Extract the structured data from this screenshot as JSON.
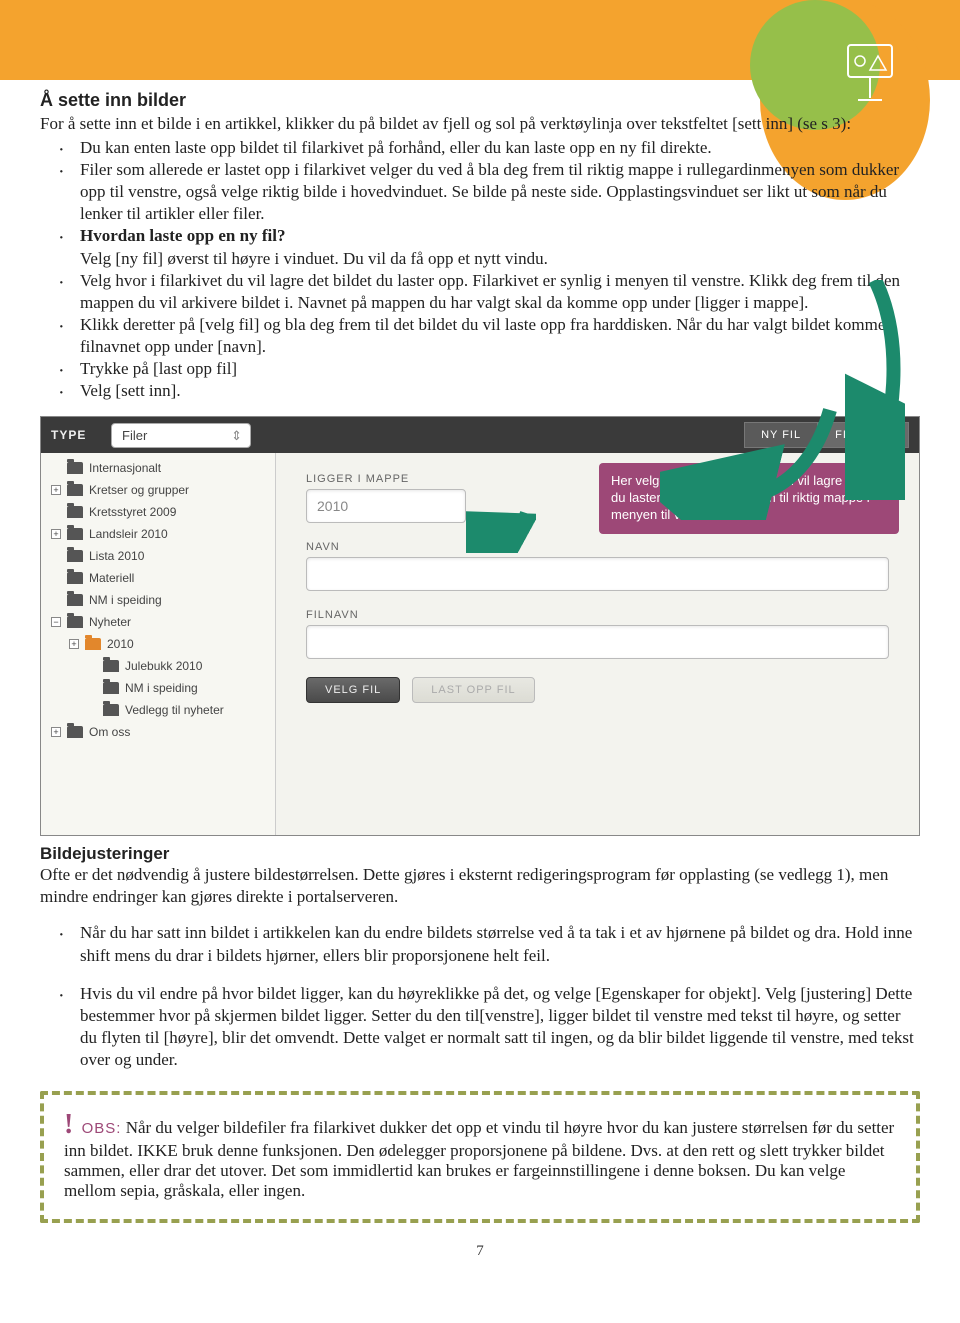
{
  "page_number": "7",
  "section1": {
    "heading": "Å sette inn bilder",
    "intro": "For å sette inn et bilde i en artikkel, klikker du på bildet av fjell og sol på verktøylinja over tekstfeltet [sett inn] (se s 3):",
    "bullets": [
      "Du kan enten laste opp bildet til filarkivet på forhånd, eller du kan laste opp en ny fil direkte.",
      "Filer som allerede er lastet opp i filarkivet velger du ved å bla deg frem til riktig mappe i rullegardinmenyen som dukker opp til venstre, også velge riktig bilde i hovedvinduet. Se bilde på neste side. Opplastingsvinduet ser likt ut som når du lenker til artikler eller filer.",
      "",
      "Velg [ny fil] øverst til høyre i vinduet. Du vil da få opp et nytt vindu.",
      "Velg hvor i filarkivet du vil lagre det bildet du laster opp. Filarkivet er synlig i menyen til venstre. Klikk deg frem til den mappen du vil arkivere bildet i. Navnet på mappen du har valgt skal da komme opp under [ligger i mappe].",
      "Klikk deretter på [velg fil] og bla deg frem til det bildet du vil laste opp fra harddisken. Når du har valgt bildet kommer filnavnet opp under [navn].",
      "Trykke på [last opp fil]",
      "Velg [sett inn]."
    ],
    "bold_q": "Hvordan laste opp en ny fil?"
  },
  "cms": {
    "type_label": "TYPE",
    "type_value": "Filer",
    "btn_nyfil": "NY FIL",
    "btn_filarkiv": "FILARKIV",
    "tree": [
      {
        "depth": 1,
        "exp": "",
        "name": "Internasjonalt"
      },
      {
        "depth": 1,
        "exp": "+",
        "name": "Kretser og grupper"
      },
      {
        "depth": 1,
        "exp": "",
        "name": "Kretsstyret 2009"
      },
      {
        "depth": 1,
        "exp": "+",
        "name": "Landsleir 2010"
      },
      {
        "depth": 1,
        "exp": "",
        "name": "Lista 2010"
      },
      {
        "depth": 1,
        "exp": "",
        "name": "Materiell"
      },
      {
        "depth": 1,
        "exp": "",
        "name": "NM i speiding"
      },
      {
        "depth": 1,
        "exp": "−",
        "name": "Nyheter"
      },
      {
        "depth": 2,
        "exp": "+",
        "name": "2010",
        "open": true
      },
      {
        "depth": 3,
        "exp": "",
        "name": "Julebukk 2010"
      },
      {
        "depth": 3,
        "exp": "",
        "name": "NM i speiding"
      },
      {
        "depth": 3,
        "exp": "",
        "name": "Vedlegg til nyheter"
      },
      {
        "depth": 1,
        "exp": "+",
        "name": "Om oss"
      }
    ],
    "form": {
      "ligger_i_mappe_label": "LIGGER I MAPPE",
      "ligger_i_mappe_value": "2010",
      "navn_label": "NAVN",
      "navn_value": "",
      "filnavn_label": "FILNAVN",
      "filnavn_value": "",
      "velg_fil_btn": "VELG FIL",
      "last_opp_btn": "LAST OPP FIL"
    },
    "callout": "Her velger du hvor i filarkivet du vil lagre bildet du laster opp. Klikk deg frem til riktig mappe i menyen til venstre."
  },
  "section2": {
    "heading": "Bildejusteringer",
    "intro": "Ofte er det nødvendig å justere bildestørrelsen. Dette gjøres i eksternt redigeringsprogram før opplasting (se vedlegg 1), men mindre endringer kan gjøres direkte i portalserveren.",
    "bullets": [
      "Når du har satt inn bildet i artikkelen kan du endre bildets størrelse ved å ta tak i et av hjørnene på bildet og dra. Hold inne shift mens du drar i bildets hjørner, ellers blir proporsjonene helt feil.",
      "Hvis du vil endre på hvor bildet ligger, kan du høyreklikke på det, og velge [Egenskaper for objekt]. Velg [justering] Dette bestemmer hvor på skjermen bildet ligger. Setter du den til[venstre], ligger bildet til venstre med tekst til høyre, og setter du flyten til [høyre], blir det omvendt. Dette valget er normalt satt til ingen, og da blir bildet liggende til venstre, med tekst over og under."
    ]
  },
  "obs": {
    "label": "OBS:",
    "text": "Når du velger bildefiler fra filarkivet dukker det opp et vindu til høyre hvor du kan justere størrelsen før du setter inn bildet. IKKE bruk denne funksjonen. Den ødelegger proporsjonene på bildene. Dvs. at den rett og slett trykker bildet sammen, eller drar det utover. Det som immidlertid kan brukes er fargeinnstillingene i denne boksen. Du kan velge mellom sepia, gråskala, eller ingen."
  }
}
